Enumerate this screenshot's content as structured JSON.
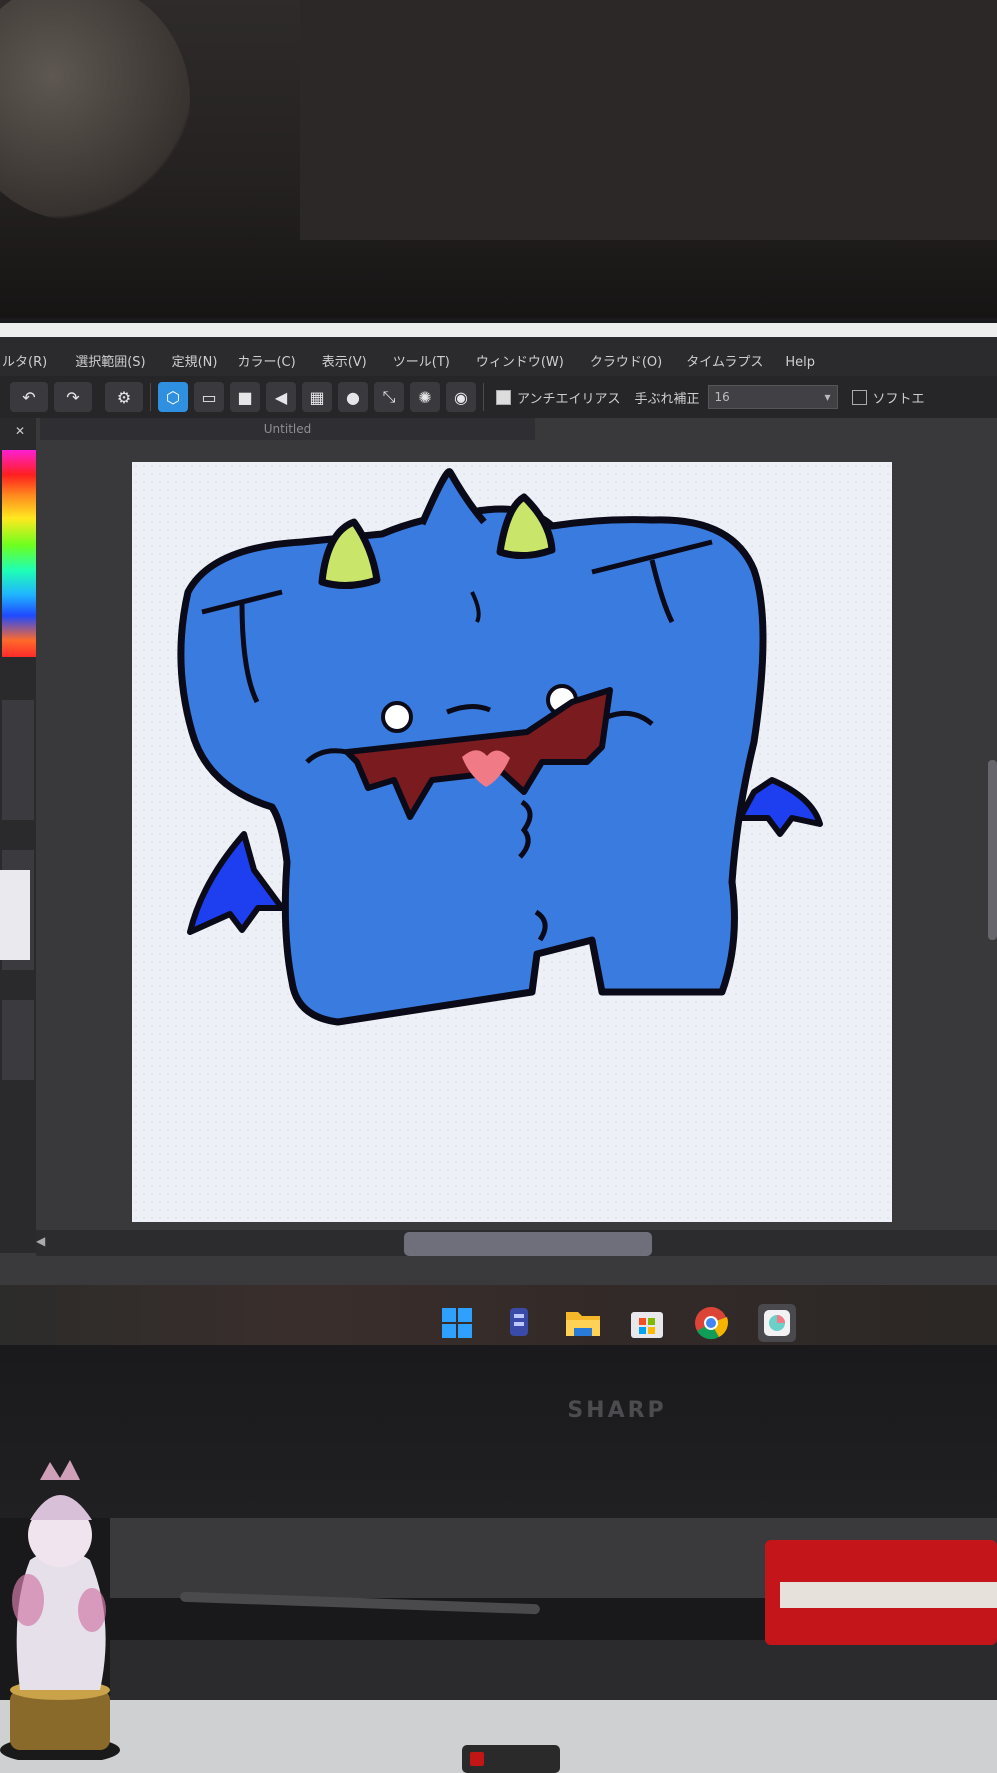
{
  "menubar": {
    "items": [
      "ルタ(R)",
      "選択範囲(S)",
      "定規(N)",
      "カラー(C)",
      "表示(V)",
      "ツール(T)",
      "ウィンドウ(W)",
      "クラウド(O)",
      "タイムラプス",
      "Help"
    ]
  },
  "toolbar": {
    "antialias_label": "アンチエイリアス",
    "stabilizer_label": "手ぶれ補正",
    "stabilizer_value": "16",
    "soft_label": "ソフトエ"
  },
  "document": {
    "tab_title": "Untitled"
  },
  "monitor": {
    "brand": "SHARP"
  },
  "colors": {
    "menubar_bg": "#2b2b2e",
    "tool_active": "#2f8fe0",
    "character_fill": "#3a7be0",
    "horns": "#c9e56a",
    "wings": "#1d3ff0",
    "mouth": "#7a1c1f",
    "tongue": "#f07a86"
  },
  "taskbar": {
    "icons": [
      "windows-start-icon",
      "app-icon",
      "file-explorer-icon",
      "microsoft-store-icon",
      "chrome-icon",
      "medibang-icon"
    ]
  }
}
